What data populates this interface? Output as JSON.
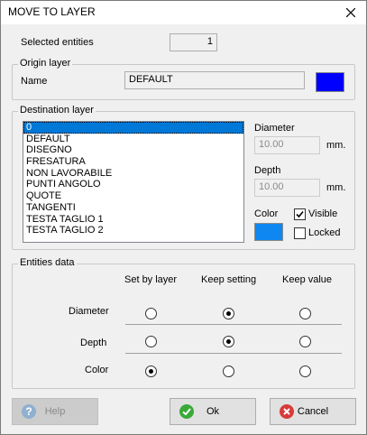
{
  "window": {
    "title": "MOVE TO LAYER"
  },
  "selected_entities": {
    "label": "Selected entities",
    "value": "1"
  },
  "origin": {
    "group_title": "Origin layer",
    "name_label": "Name",
    "name_value": "DEFAULT",
    "color": "#0000ff"
  },
  "destination": {
    "group_title": "Destination layer",
    "layers": [
      "0",
      "DEFAULT",
      "DISEGNO",
      "FRESATURA",
      "NON LAVORABILE",
      "PUNTI ANGOLO",
      "QUOTE",
      "TANGENTI",
      "TESTA TAGLIO 1",
      "TESTA TAGLIO 2"
    ],
    "selected_index": 0,
    "diameter_label": "Diameter",
    "diameter_value": "10.00",
    "diameter_unit": "mm.",
    "depth_label": "Depth",
    "depth_value": "10.00",
    "depth_unit": "mm.",
    "color_label": "Color",
    "color": "#0f87f0",
    "visible_label": "Visible",
    "visible_checked": true,
    "locked_label": "Locked",
    "locked_checked": false
  },
  "entities": {
    "group_title": "Entities data",
    "columns": [
      "Set by layer",
      "Keep setting",
      "Keep value"
    ],
    "rows": [
      {
        "label": "Diameter",
        "selected": 1
      },
      {
        "label": "Depth",
        "selected": 1
      },
      {
        "label": "Color",
        "selected": 0
      }
    ]
  },
  "buttons": {
    "help": "Help",
    "ok": "Ok",
    "cancel": "Cancel"
  },
  "colors": {
    "ok_icon": "#3aa93a",
    "cancel_icon": "#d83a3a",
    "help_icon": "#8fb0cf"
  }
}
